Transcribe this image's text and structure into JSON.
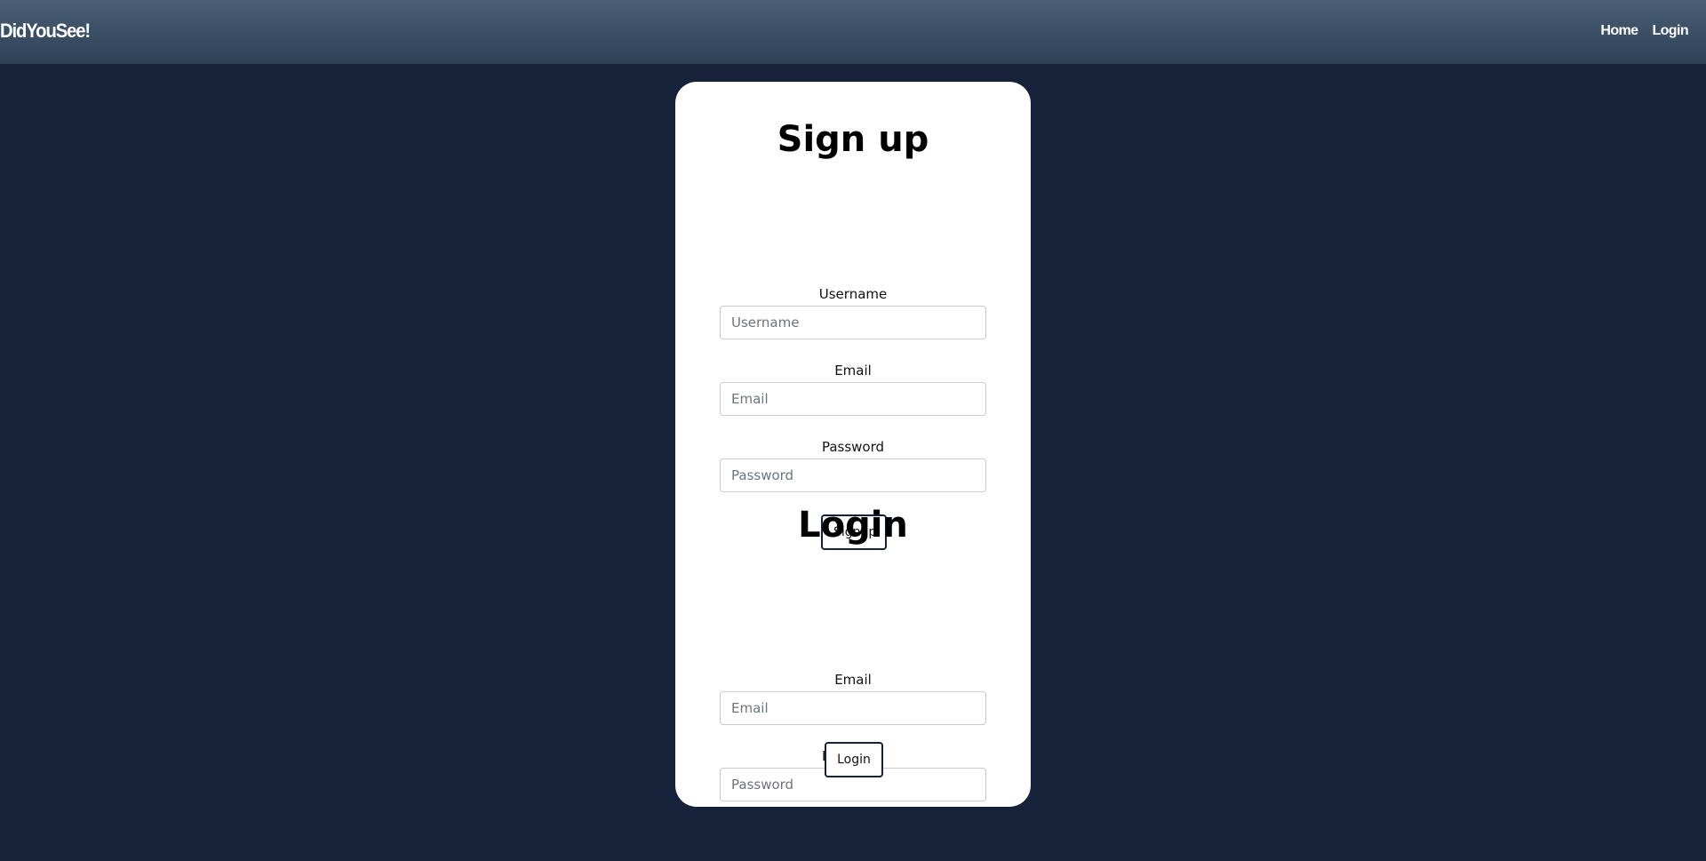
{
  "navbar": {
    "brand": "DidYouSee!",
    "links": [
      {
        "label": "Home"
      },
      {
        "label": "Login"
      }
    ]
  },
  "signup": {
    "title": "Sign up",
    "username_label": "Username",
    "username_placeholder": "Username",
    "email_label": "Email",
    "email_placeholder": "Email",
    "password_label": "Password",
    "password_placeholder": "Password",
    "button_label": "Signup"
  },
  "login": {
    "title": "Login",
    "email_label": "Email",
    "email_placeholder": "Email",
    "password_label": "Password",
    "password_placeholder": "Password",
    "button_label": "Login"
  },
  "colors": {
    "page_background": "#16213a",
    "navbar_top": "#4a5f75",
    "navbar_bottom": "#2e4157",
    "card_background": "#ffffff",
    "button_border": "#16213a"
  }
}
